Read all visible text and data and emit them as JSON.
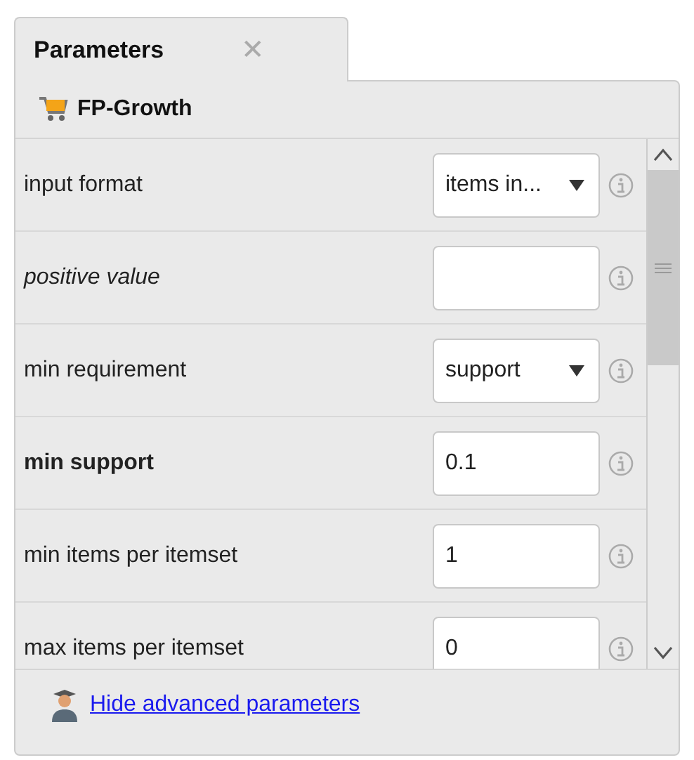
{
  "tab": {
    "title": "Parameters",
    "close": "✕"
  },
  "operator": {
    "name": "FP-Growth"
  },
  "parameters": [
    {
      "label": "input format",
      "mandatory": false,
      "optional": false,
      "kind": "dropdown",
      "value": "items in..."
    },
    {
      "label": "positive value",
      "mandatory": false,
      "optional": true,
      "kind": "text"
    },
    {
      "label": "min requirement",
      "mandatory": false,
      "optional": false,
      "kind": "dropdown",
      "value": "support"
    },
    {
      "label": "min support",
      "mandatory": true,
      "optional": false,
      "kind": "text",
      "value": "0.1"
    },
    {
      "label": "min items per itemset",
      "mandatory": false,
      "optional": false,
      "kind": "text",
      "value": "1"
    },
    {
      "label": "max items per itemset",
      "mandatory": false,
      "optional": false,
      "kind": "text",
      "value": "0"
    }
  ],
  "footer": {
    "link": "Hide advanced parameters"
  }
}
